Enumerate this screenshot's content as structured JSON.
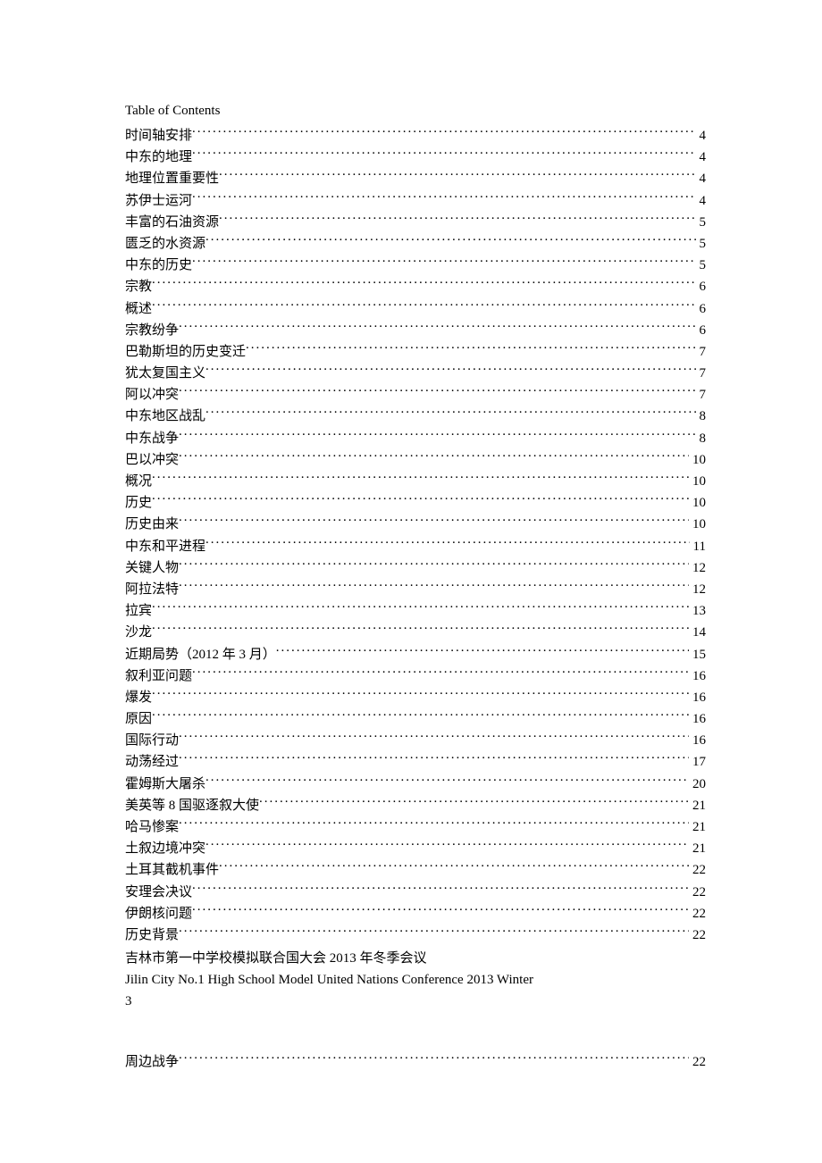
{
  "toc_title": "Table of Contents",
  "entries": [
    {
      "label": "时间轴安排",
      "page": "4"
    },
    {
      "label": "中东的地理",
      "page": "4"
    },
    {
      "label": "地理位置重要性 ",
      "page": "4"
    },
    {
      "label": "苏伊士运河 ",
      "page": "4"
    },
    {
      "label": "丰富的石油资源 ",
      "page": "5"
    },
    {
      "label": "匮乏的水资源 ",
      "page": "5"
    },
    {
      "label": "中东的历史",
      "page": "5"
    },
    {
      "label": "宗教 ",
      "page": "6"
    },
    {
      "label": "概述",
      "page": "6"
    },
    {
      "label": "宗教纷争",
      "page": "6"
    },
    {
      "label": "巴勒斯坦的历史变迁 ",
      "page": "7"
    },
    {
      "label": "犹太复国主义",
      "page": "7"
    },
    {
      "label": "阿以冲突",
      "page": "7"
    },
    {
      "label": "中东地区战乱 ",
      "page": "8"
    },
    {
      "label": "中东战争",
      "page": "8"
    },
    {
      "label": "巴以冲突",
      "page": "10"
    },
    {
      "label": "概况 ",
      "page": "10"
    },
    {
      "label": "历史 ",
      "page": "10"
    },
    {
      "label": "历史由来",
      "page": "10"
    },
    {
      "label": "中东和平进程",
      "page": "11"
    },
    {
      "label": "关键人物 ",
      "page": "12"
    },
    {
      "label": "阿拉法特",
      "page": "12"
    },
    {
      "label": "拉宾",
      "page": "13"
    },
    {
      "label": "沙龙",
      "page": "14"
    },
    {
      "label": "近期局势（2012 年 3 月） ",
      "page": "15"
    },
    {
      "label": "叙利亚问题",
      "page": "16"
    },
    {
      "label": "爆发 ",
      "page": "16"
    },
    {
      "label": "原因 ",
      "page": "16"
    },
    {
      "label": "国际行动 ",
      "page": "16"
    },
    {
      "label": "动荡经过 ",
      "page": "17"
    },
    {
      "label": "霍姆斯大屠杀 ",
      "page": "20"
    },
    {
      "label": "美英等 8 国驱逐叙大使 ",
      "page": "21"
    },
    {
      "label": "哈马惨案 ",
      "page": "21"
    },
    {
      "label": "土叙边境冲突 ",
      "page": "21"
    },
    {
      "label": "土耳其截机事件 ",
      "page": "22"
    },
    {
      "label": "安理会决议 ",
      "page": "22"
    },
    {
      "label": "伊朗核问题",
      "page": "22"
    },
    {
      "label": "历史背景 ",
      "page": "22"
    }
  ],
  "footer": {
    "line1": "吉林市第一中学校模拟联合国大会 2013 年冬季会议",
    "line2": "Jilin City No.1 High School Model United Nations Conference 2013 Winter",
    "page_number": "3"
  },
  "after_gap_entry": {
    "label": "周边战争 ",
    "page": "22"
  }
}
